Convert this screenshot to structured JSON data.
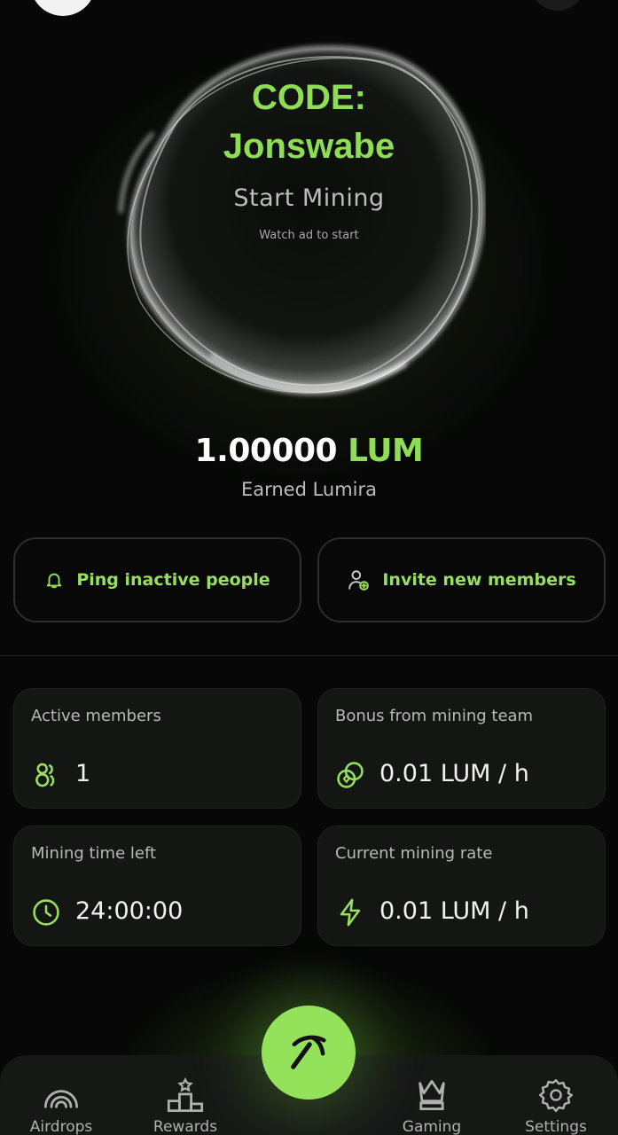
{
  "orb": {
    "code_line1": "CODE:",
    "code_line2": "Jonswabe",
    "title": "Start Mining",
    "subtitle": "Watch ad to start"
  },
  "balance": {
    "amount": "1.00000",
    "currency": "LUM",
    "label": "Earned Lumira"
  },
  "actions": {
    "ping_label": "Ping inactive people",
    "invite_label": "Invite new members"
  },
  "stats": {
    "active_members_label": "Active members",
    "active_members_value": "1",
    "bonus_label": "Bonus from mining team",
    "bonus_value": "0.01 LUM / h",
    "time_left_label": "Mining time left",
    "time_left_value": "24:00:00",
    "rate_label": "Current mining rate",
    "rate_value": "0.01 LUM / h"
  },
  "nav": {
    "airdrops": "Airdrops",
    "rewards": "Rewards",
    "gaming": "Gaming",
    "settings": "Settings"
  },
  "icons": {
    "ping": "bell-icon",
    "invite": "user-plus-icon",
    "members": "users-icon",
    "bonus": "coins-icon",
    "time": "clock-icon",
    "rate": "lightning-icon",
    "airdrops": "broadcast-icon",
    "rewards": "podium-icon",
    "mine": "pickaxe-icon",
    "gaming": "chess-queen-icon",
    "settings": "gear-icon"
  },
  "colors": {
    "accent": "#8fdc55",
    "background": "#060706",
    "card": "#141614"
  }
}
